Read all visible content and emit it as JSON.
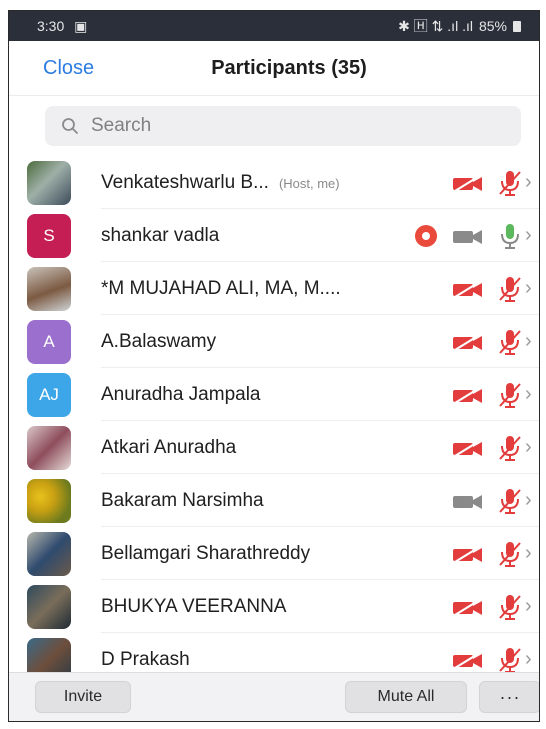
{
  "status_bar": {
    "time": "3:30",
    "time_icon": "calendar-icon",
    "indicators": "✱ 🄷 ⇅ .ıl .ıl",
    "battery": "85%"
  },
  "header": {
    "close_label": "Close",
    "title": "Participants (35)"
  },
  "search": {
    "placeholder": "Search"
  },
  "participants": [
    {
      "name": "Venkateshwarlu B...",
      "tag": "(Host, me)",
      "avatar": "photo",
      "video": "off",
      "mic": "off"
    },
    {
      "name": "shankar vadla",
      "avatar": "S",
      "avatar_color": "#c41e55",
      "recording": true,
      "video": "on",
      "mic": "on"
    },
    {
      "name": "*M MUJAHAD ALI, MA, M....",
      "avatar": "photo",
      "video": "off",
      "mic": "off"
    },
    {
      "name": "A.Balaswamy",
      "avatar": "A",
      "avatar_color": "#9a6fcd",
      "video": "off",
      "mic": "off"
    },
    {
      "name": "Anuradha Jampala",
      "avatar": "AJ",
      "avatar_color": "#3da6e8",
      "video": "off",
      "mic": "off"
    },
    {
      "name": "Atkari Anuradha",
      "avatar": "photo",
      "video": "off",
      "mic": "off"
    },
    {
      "name": "Bakaram Narsimha",
      "avatar": "photo",
      "video": "on",
      "mic": "off"
    },
    {
      "name": "Bellamgari Sharathreddy",
      "avatar": "photo",
      "video": "off",
      "mic": "off"
    },
    {
      "name": "BHUKYA VEERANNA",
      "avatar": "photo",
      "video": "off",
      "mic": "off"
    },
    {
      "name": "D Prakash",
      "avatar": "photo",
      "video": "off",
      "mic": "off"
    }
  ],
  "footer": {
    "invite_label": "Invite",
    "mute_all_label": "Mute All",
    "more_label": "···"
  },
  "colors": {
    "accent": "#2d7de0",
    "muted_red": "#e23c3c",
    "mic_on_green": "#5cb85c",
    "video_on_gray": "#8a8a8a"
  }
}
